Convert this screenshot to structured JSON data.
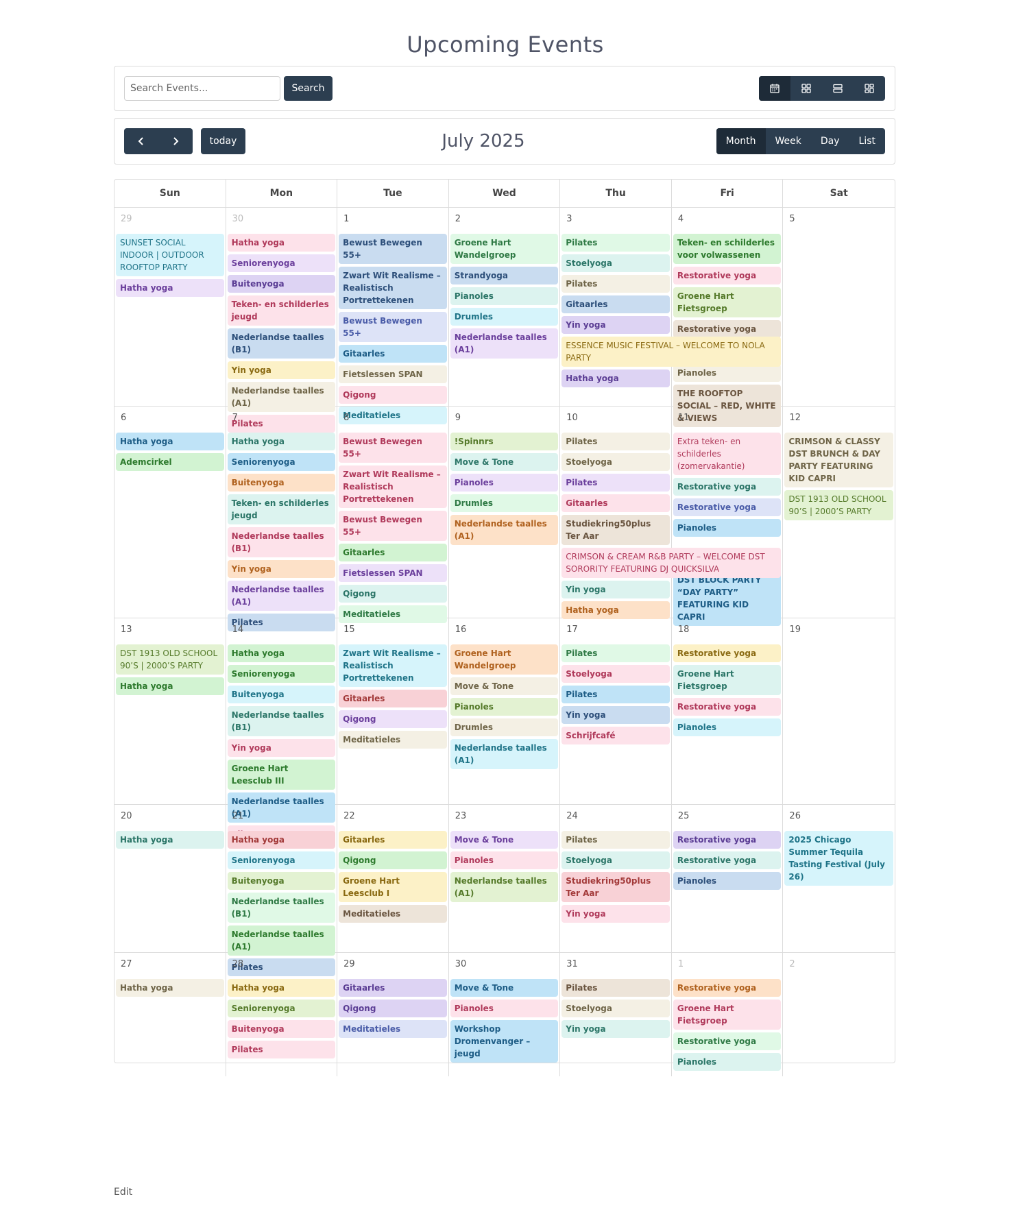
{
  "page": {
    "title": "Upcoming Events",
    "edit_link": "Edit"
  },
  "toolbar": {
    "search_placeholder": "Search Events...",
    "search_label": "Search",
    "views": [
      "calendar-icon",
      "grid-icon",
      "list-icon",
      "tiles-icon"
    ],
    "active_view": "calendar-icon"
  },
  "calendar_header": {
    "prev_icon": "chevron-left-icon",
    "next_icon": "chevron-right-icon",
    "today_label": "today",
    "month_title": "July 2025",
    "ranges": [
      "Month",
      "Week",
      "Day",
      "List"
    ],
    "active_range": "Month"
  },
  "days_of_week": [
    "Sun",
    "Mon",
    "Tue",
    "Wed",
    "Thu",
    "Fri",
    "Sat"
  ],
  "weeks": [
    {
      "height": 290,
      "days": [
        {
          "num": "29",
          "other": true,
          "events": [
            {
              "title": "SUNSET SOCIAL INDOOR | OUTDOOR ROOFTOP PARTY",
              "color": "cyan",
              "light": true
            },
            {
              "title": "Hatha yoga",
              "color": "lav"
            }
          ]
        },
        {
          "num": "30",
          "other": true,
          "events": [
            {
              "title": "Hatha yoga",
              "color": "pink"
            },
            {
              "title": "Seniorenyoga",
              "color": "lav"
            },
            {
              "title": "Buitenyoga",
              "color": "purple"
            },
            {
              "title": "Teken- en schilderles jeugd",
              "color": "pink"
            },
            {
              "title": "Nederlandse taalles (B1)",
              "color": "blue"
            },
            {
              "title": "Yin yoga",
              "color": "yellow"
            },
            {
              "title": "Nederlandse taalles (A1)",
              "color": "cream"
            },
            {
              "title": "Pilates",
              "color": "pink"
            }
          ]
        },
        {
          "num": "1",
          "events": [
            {
              "title": "Bewust Bewegen 55+",
              "color": "blue"
            },
            {
              "title": "Zwart Wit Realisme – Realistisch Portrettekenen",
              "color": "blue"
            },
            {
              "title": "Bewust Bewegen 55+",
              "color": "indigo"
            },
            {
              "title": "Gitaarles",
              "color": "sky"
            },
            {
              "title": "Fietslessen SPAN",
              "color": "cream"
            },
            {
              "title": "Qigong",
              "color": "pink"
            },
            {
              "title": "Meditatieles",
              "color": "cyan"
            }
          ]
        },
        {
          "num": "2",
          "events": [
            {
              "title": "Groene Hart Wandelgroep",
              "color": "mint"
            },
            {
              "title": "Strandyoga",
              "color": "blue"
            },
            {
              "title": "Pianoles",
              "color": "teal"
            },
            {
              "title": "Drumles",
              "color": "cyan"
            },
            {
              "title": "Nederlandse taalles (A1)",
              "color": "lav"
            }
          ]
        },
        {
          "num": "3",
          "events": [
            {
              "title": "Pilates",
              "color": "mint"
            },
            {
              "title": "Stoelyoga",
              "color": "teal"
            },
            {
              "title": "Pilates",
              "color": "cream"
            },
            {
              "title": "Gitaarles",
              "color": "blue"
            },
            {
              "title": "Yin yoga",
              "color": "purple"
            },
            {
              "title": "ESSENCE MUSIC FESTIVAL – WELCOME TO NOLA PARTY",
              "color": "yellow",
              "light": true,
              "span2": true
            },
            {
              "title": "Hatha yoga",
              "color": "purple"
            }
          ]
        },
        {
          "num": "4",
          "events": [
            {
              "title": "Teken- en schilderles voor volwassenen",
              "color": "green"
            },
            {
              "title": "Restorative yoga",
              "color": "pink"
            },
            {
              "title": "Groene Hart Fietsgroep",
              "color": "lime"
            },
            {
              "title": "Restorative yoga",
              "color": "beige"
            },
            {
              "spacer": true
            },
            {
              "title": "Pianoles",
              "color": "cream"
            },
            {
              "title": "THE ROOFTOP SOCIAL – RED, WHITE & VIEWS",
              "color": "beige"
            }
          ]
        },
        {
          "num": "5",
          "events": []
        }
      ]
    },
    {
      "height": 309,
      "days": [
        {
          "num": "6",
          "events": [
            {
              "title": "Hatha yoga",
              "color": "sky"
            },
            {
              "title": "Ademcirkel",
              "color": "green"
            }
          ]
        },
        {
          "num": "7",
          "events": [
            {
              "title": "Hatha yoga",
              "color": "teal"
            },
            {
              "title": "Seniorenyoga",
              "color": "sky"
            },
            {
              "title": "Buitenyoga",
              "color": "peach"
            },
            {
              "title": "Teken- en schilderles jeugd",
              "color": "teal"
            },
            {
              "title": "Nederlandse taalles (B1)",
              "color": "pink"
            },
            {
              "title": "Yin yoga",
              "color": "peach"
            },
            {
              "title": "Nederlandse taalles (A1)",
              "color": "lav"
            },
            {
              "title": "Pilates",
              "color": "blue"
            }
          ]
        },
        {
          "num": "8",
          "events": [
            {
              "title": "Bewust Bewegen 55+",
              "color": "pink"
            },
            {
              "title": "Zwart Wit Realisme – Realistisch Portrettekenen",
              "color": "pink"
            },
            {
              "title": "Bewust Bewegen 55+",
              "color": "pink"
            },
            {
              "title": "Gitaarles",
              "color": "green"
            },
            {
              "title": "Fietslessen SPAN",
              "color": "lav"
            },
            {
              "title": "Qigong",
              "color": "teal"
            },
            {
              "title": "Meditatieles",
              "color": "mint"
            }
          ]
        },
        {
          "num": "9",
          "events": [
            {
              "title": "!Spinnrs",
              "color": "lime"
            },
            {
              "title": "Move & Tone",
              "color": "teal"
            },
            {
              "title": "Pianoles",
              "color": "lav"
            },
            {
              "title": "Drumles",
              "color": "mint"
            },
            {
              "title": "Nederlandse taalles (A1)",
              "color": "peach"
            }
          ]
        },
        {
          "num": "10",
          "events": [
            {
              "title": "Pilates",
              "color": "cream"
            },
            {
              "title": "Stoelyoga",
              "color": "cream"
            },
            {
              "title": "Pilates",
              "color": "lav"
            },
            {
              "title": "Gitaarles",
              "color": "pink"
            },
            {
              "title": "Studiekring50plus Ter Aar",
              "color": "beige"
            },
            {
              "title": "CRIMSON & CREAM R&B PARTY – WELCOME DST SORORITY FEATURING DJ QUICKSILVA",
              "color": "pink",
              "light": true,
              "span2": true
            },
            {
              "title": "Yin yoga",
              "color": "teal"
            },
            {
              "title": "Hatha yoga",
              "color": "peach"
            }
          ]
        },
        {
          "num": "11",
          "events": [
            {
              "title": "Extra teken- en schilderles (zomervakantie)",
              "color": "pink",
              "light": true
            },
            {
              "title": "Restorative yoga",
              "color": "teal"
            },
            {
              "title": "Restorative yoga",
              "color": "indigo"
            },
            {
              "title": "Pianoles",
              "color": "sky"
            },
            {
              "spacer": true,
              "tall": true
            },
            {
              "title": "DST BLOCK PARTY “DAY PARTY” FEATURING KID CAPRI",
              "color": "sky"
            }
          ]
        },
        {
          "num": "12",
          "events": [
            {
              "title": "CRIMSON & CLASSY DST BRUNCH & DAY PARTY FEATURING KID CAPRI",
              "color": "cream"
            },
            {
              "title": "DST 1913 OLD SCHOOL 90’S | 2000’S PARTY",
              "color": "lime",
              "light": true
            }
          ]
        }
      ]
    },
    {
      "height": 272,
      "days": [
        {
          "num": "13",
          "events": [
            {
              "title": "DST 1913 OLD SCHOOL 90’S | 2000’S PARTY",
              "color": "lime",
              "light": true
            },
            {
              "title": "Hatha yoga",
              "color": "green"
            }
          ]
        },
        {
          "num": "14",
          "events": [
            {
              "title": "Hatha yoga",
              "color": "green"
            },
            {
              "title": "Seniorenyoga",
              "color": "green"
            },
            {
              "title": "Buitenyoga",
              "color": "cyan"
            },
            {
              "title": "Nederlandse taalles (B1)",
              "color": "teal"
            },
            {
              "title": "Yin yoga",
              "color": "pink"
            },
            {
              "title": "Groene Hart Leesclub III",
              "color": "green"
            },
            {
              "title": "Nederlandse taalles (A1)",
              "color": "sky"
            },
            {
              "title": "Pilates",
              "color": "pink"
            }
          ]
        },
        {
          "num": "15",
          "events": [
            {
              "title": "Zwart Wit Realisme – Realistisch Portrettekenen",
              "color": "cyan"
            },
            {
              "title": "Gitaarles",
              "color": "rose"
            },
            {
              "title": "Qigong",
              "color": "lav"
            },
            {
              "title": "Meditatieles",
              "color": "cream"
            }
          ]
        },
        {
          "num": "16",
          "events": [
            {
              "title": "Groene Hart Wandelgroep",
              "color": "peach"
            },
            {
              "title": "Move & Tone",
              "color": "cream"
            },
            {
              "title": "Pianoles",
              "color": "lime"
            },
            {
              "title": "Drumles",
              "color": "cream"
            },
            {
              "title": "Nederlandse taalles (A1)",
              "color": "cyan"
            }
          ]
        },
        {
          "num": "17",
          "events": [
            {
              "title": "Pilates",
              "color": "mint"
            },
            {
              "title": "Stoelyoga",
              "color": "pink"
            },
            {
              "title": "Pilates",
              "color": "sky"
            },
            {
              "title": "Yin yoga",
              "color": "blue"
            },
            {
              "title": "Schrijfcafé",
              "color": "pink"
            }
          ]
        },
        {
          "num": "18",
          "events": [
            {
              "title": "Restorative yoga",
              "color": "yellow"
            },
            {
              "title": "Groene Hart Fietsgroep",
              "color": "teal"
            },
            {
              "title": "Restorative yoga",
              "color": "pink"
            },
            {
              "title": "Pianoles",
              "color": "cyan"
            }
          ]
        },
        {
          "num": "19",
          "events": []
        }
      ]
    },
    {
      "height": 216,
      "days": [
        {
          "num": "20",
          "events": [
            {
              "title": "Hatha yoga",
              "color": "teal"
            }
          ]
        },
        {
          "num": "21",
          "events": [
            {
              "title": "Hatha yoga",
              "color": "rose"
            },
            {
              "title": "Seniorenyoga",
              "color": "cyan"
            },
            {
              "title": "Buitenyoga",
              "color": "lime"
            },
            {
              "title": "Nederlandse taalles (B1)",
              "color": "mint"
            },
            {
              "title": "Nederlandse taalles (A1)",
              "color": "green"
            },
            {
              "title": "Pilates",
              "color": "blue"
            }
          ]
        },
        {
          "num": "22",
          "events": [
            {
              "title": "Gitaarles",
              "color": "yellow"
            },
            {
              "title": "Qigong",
              "color": "green"
            },
            {
              "title": "Groene Hart Leesclub I",
              "color": "yellow"
            },
            {
              "title": "Meditatieles",
              "color": "beige"
            }
          ]
        },
        {
          "num": "23",
          "events": [
            {
              "title": "Move & Tone",
              "color": "lav"
            },
            {
              "title": "Pianoles",
              "color": "pink"
            },
            {
              "title": "Nederlandse taalles (A1)",
              "color": "lime"
            }
          ]
        },
        {
          "num": "24",
          "events": [
            {
              "title": "Pilates",
              "color": "cream"
            },
            {
              "title": "Stoelyoga",
              "color": "teal"
            },
            {
              "title": "Studiekring50plus Ter Aar",
              "color": "rose"
            },
            {
              "title": "Yin yoga",
              "color": "pink"
            }
          ]
        },
        {
          "num": "25",
          "events": [
            {
              "title": "Restorative yoga",
              "color": "purple"
            },
            {
              "title": "Restorative yoga",
              "color": "teal"
            },
            {
              "title": "Pianoles",
              "color": "blue"
            }
          ]
        },
        {
          "num": "26",
          "events": [
            {
              "title": "2025 Chicago Summer Tequila Tasting Festival (July 26)",
              "color": "cyan"
            }
          ]
        }
      ]
    },
    {
      "height": 160,
      "days": [
        {
          "num": "27",
          "events": [
            {
              "title": "Hatha yoga",
              "color": "cream"
            }
          ]
        },
        {
          "num": "28",
          "events": [
            {
              "title": "Hatha yoga",
              "color": "yellow"
            },
            {
              "title": "Seniorenyoga",
              "color": "lime"
            },
            {
              "title": "Buitenyoga",
              "color": "pink"
            },
            {
              "title": "Pilates",
              "color": "pink"
            }
          ]
        },
        {
          "num": "29",
          "events": [
            {
              "title": "Gitaarles",
              "color": "purple"
            },
            {
              "title": "Qigong",
              "color": "purple"
            },
            {
              "title": "Meditatieles",
              "color": "indigo"
            }
          ]
        },
        {
          "num": "30",
          "events": [
            {
              "title": "Move & Tone",
              "color": "sky"
            },
            {
              "title": "Pianoles",
              "color": "pink"
            },
            {
              "title": "Workshop Dromenvanger – jeugd",
              "color": "sky"
            }
          ]
        },
        {
          "num": "31",
          "events": [
            {
              "title": "Pilates",
              "color": "beige"
            },
            {
              "title": "Stoelyoga",
              "color": "cream"
            },
            {
              "title": "Yin yoga",
              "color": "teal"
            }
          ]
        },
        {
          "num": "1",
          "other": true,
          "events": [
            {
              "title": "Restorative yoga",
              "color": "peach"
            },
            {
              "title": "Groene Hart Fietsgroep",
              "color": "pink"
            },
            {
              "title": "Restorative yoga",
              "color": "mint"
            },
            {
              "title": "Pianoles",
              "color": "teal"
            }
          ]
        },
        {
          "num": "2",
          "other": true,
          "events": []
        }
      ]
    }
  ]
}
